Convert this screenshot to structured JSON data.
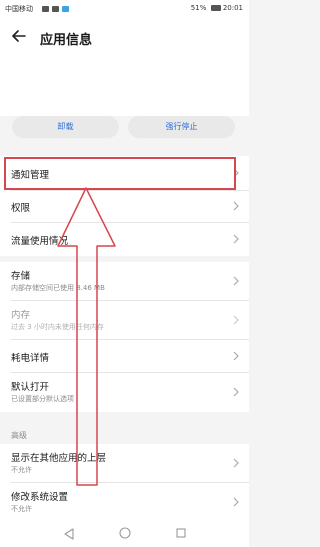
{
  "status_bar": {
    "carrier": "中国移动",
    "battery": "51%",
    "time": "20:01"
  },
  "header": {
    "title": "应用信息"
  },
  "buttons": {
    "uninstall": "卸载",
    "force_stop": "强行停止"
  },
  "section1": {
    "notification": "通知管理",
    "permissions": "权限",
    "data_usage": "流量使用情况"
  },
  "section2": {
    "storage": {
      "label": "存储",
      "sub": "内部存储空间已使用 8.46 MB"
    },
    "memory": {
      "label": "内存",
      "sub": "过去 3 小时内未使用任何内存"
    },
    "battery": {
      "label": "耗电详情"
    },
    "default_open": {
      "label": "默认打开",
      "sub": "已设置部分默认选项"
    }
  },
  "advanced": {
    "header": "高级",
    "overlay": {
      "label": "显示在其他应用的上层",
      "sub": "不允许"
    },
    "modify_settings": {
      "label": "修改系统设置",
      "sub": "不允许"
    }
  },
  "annotation_color": "#d8474d"
}
